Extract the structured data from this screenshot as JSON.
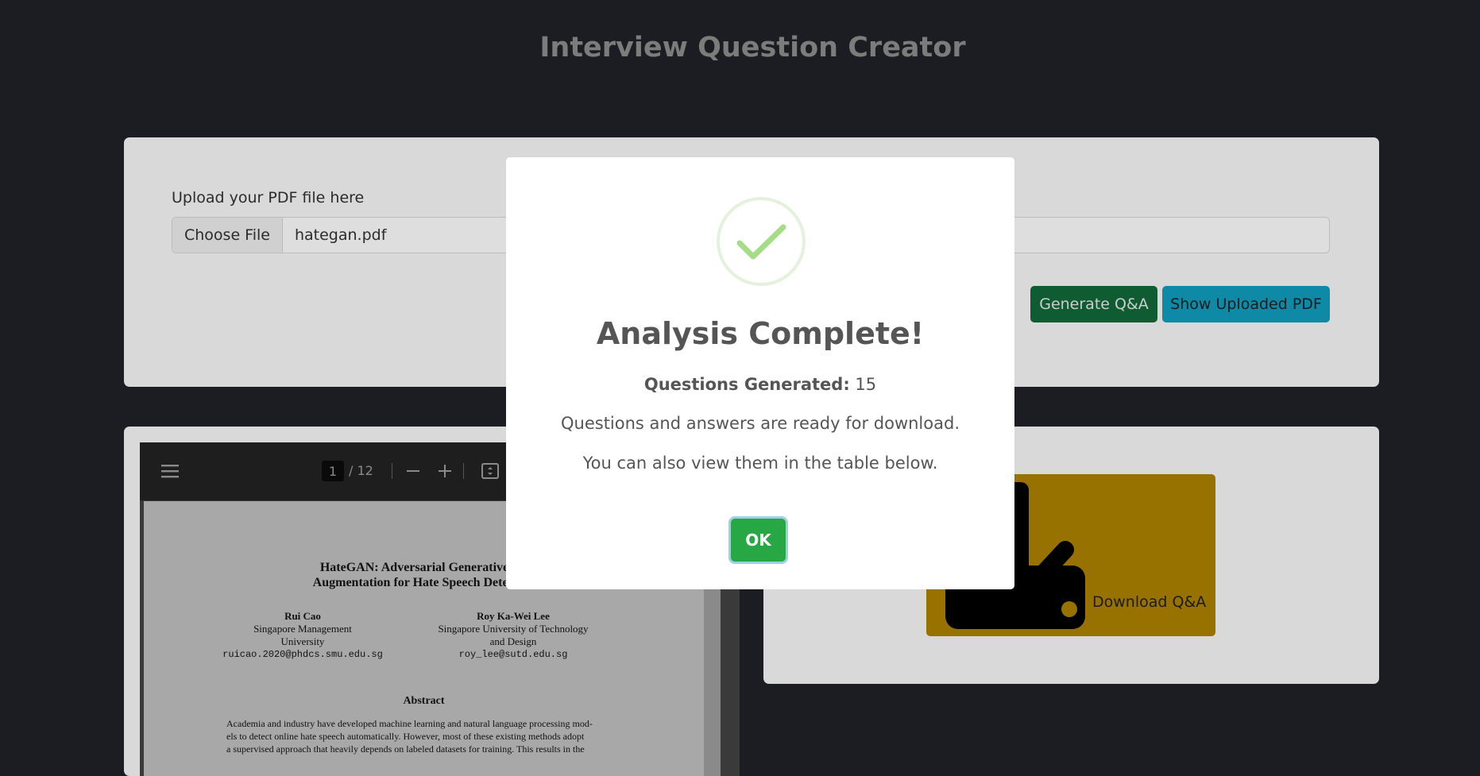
{
  "app": {
    "title": "Interview Question Creator"
  },
  "upload": {
    "label": "Upload your PDF file here",
    "choose_label": "Choose File",
    "file_name": "hategan.pdf",
    "generate_label": "Generate Q&A",
    "show_pdf_label": "Show Uploaded PDF"
  },
  "pdf_viewer": {
    "page_current": "1",
    "page_total": "/ 12",
    "doc": {
      "title_line1": "HateGAN: Adversarial Generative-Ba",
      "title_line2": "Augmentation for Hate Speech Detection",
      "author1": {
        "name": "Rui Cao",
        "aff1": "Singapore Management",
        "aff2": "University",
        "email": "ruicao.2020@phdcs.smu.edu.sg"
      },
      "author2": {
        "name": "Roy Ka-Wei Lee",
        "aff1": "Singapore University of Technology",
        "aff2": "and Design",
        "email": "roy_lee@sutd.edu.sg"
      },
      "abstract_heading": "Abstract",
      "abstract_lines": [
        "Academia and industry have developed machine learning and natural language processing mod-",
        "els to detect online hate speech automatically. However, most of these existing methods adopt",
        "a supervised approach that heavily depends on labeled datasets for training. This results in the"
      ]
    }
  },
  "download": {
    "label": "Download Q&A"
  },
  "modal": {
    "title": "Analysis Complete!",
    "count_label": "Questions Generated:",
    "count_value": "15",
    "line1": "Questions and answers are ready for download.",
    "line2": "You can also view them in the table below.",
    "ok_label": "OK"
  },
  "colors": {
    "success": "#28a745",
    "generate_button": "#0f5c33",
    "show_pdf_button": "#0e8aa6",
    "download_button": "#977200",
    "checkmark": "#a5dc86"
  },
  "icons": [
    "hamburger-icon",
    "zoom-out-icon",
    "zoom-in-icon",
    "page-fit-icon",
    "success-check-icon",
    "download-icon"
  ]
}
